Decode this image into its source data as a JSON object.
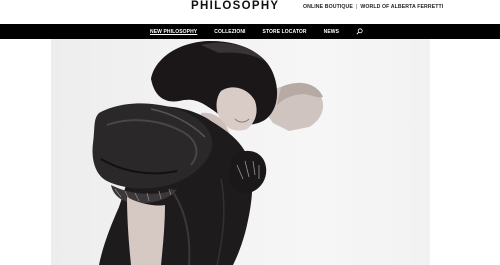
{
  "header": {
    "logo": "PHILOSOPHY",
    "links": [
      "ONLINE BOUTIQUE",
      "WORLD OF ALBERTA FERRETTI"
    ],
    "separator": "|"
  },
  "nav": {
    "items": [
      {
        "label": "NEW PHILOSOPHY",
        "active": true
      },
      {
        "label": "COLLEZIONI",
        "active": false
      },
      {
        "label": "STORE LOCATOR",
        "active": false
      },
      {
        "label": "NEWS",
        "active": false
      }
    ],
    "search_icon": "search-icon"
  },
  "hero": {
    "image": "model-in-black-leather-ruffled-dress",
    "background_color": "#f0f0f0"
  },
  "colors": {
    "navbar": "#000000",
    "text": "#111111"
  }
}
